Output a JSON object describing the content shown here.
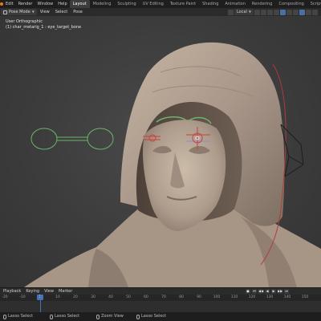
{
  "topbar": {
    "menus": [
      "Edit",
      "Render",
      "Window",
      "Help"
    ],
    "workspaces": [
      "Layout",
      "Modeling",
      "Sculpting",
      "UV Editing",
      "Texture Paint",
      "Shading",
      "Animation",
      "Rendering",
      "Compositing",
      "Scripting"
    ],
    "active_workspace": "Layout",
    "add_tab": "+"
  },
  "header": {
    "mode": "Pose Mode",
    "menus": [
      "View",
      "Select",
      "Pose"
    ],
    "orientation": "Local"
  },
  "viewport": {
    "view_name": "User Orthographic",
    "object_info": "(1) char_metarig_1 : eye_target_bone"
  },
  "timeline": {
    "menus": [
      "Playback",
      "Keying",
      "View",
      "Marker"
    ],
    "ticks": [
      "-20",
      "-10",
      "0",
      "10",
      "20",
      "30",
      "40",
      "50",
      "60",
      "70",
      "80",
      "90",
      "100",
      "110",
      "120",
      "130",
      "140",
      "150"
    ],
    "current_frame": "1",
    "controls": [
      "●",
      "⏮",
      "◀◀",
      "◀",
      "▶",
      "▶▶",
      "⏭"
    ]
  },
  "statusbar": {
    "left": "Lasso Select",
    "middle": "Lasso Select",
    "zoom": "Zoom View",
    "right": "Lasso Select"
  },
  "colors": {
    "accent": "#4772b3",
    "active_tab_bg": "#3d3d3d",
    "bone_green": "#6db36b",
    "bone_red": "#c94040",
    "skin": "#bcab98"
  }
}
